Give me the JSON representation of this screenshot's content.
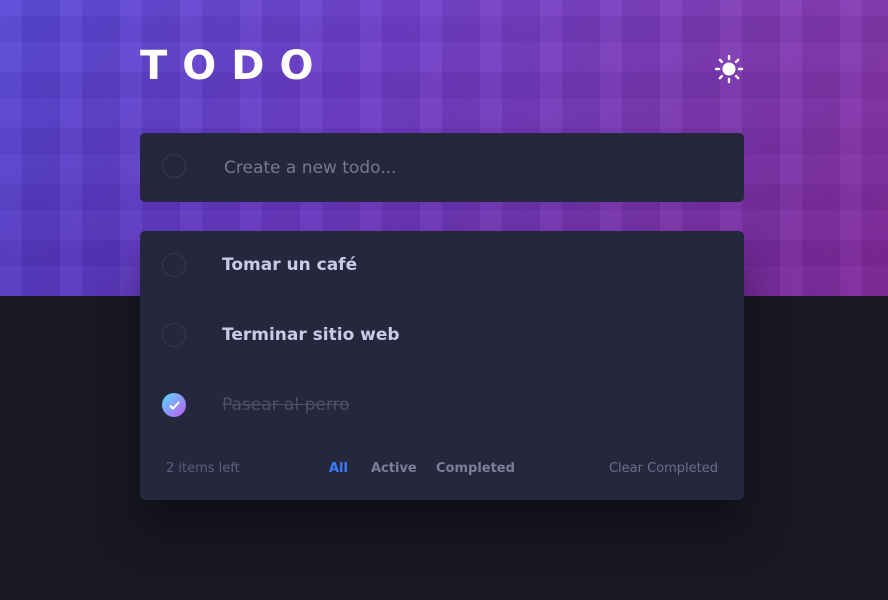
{
  "app": {
    "title": "TODO",
    "theme_icon": "sun-icon"
  },
  "new_todo": {
    "placeholder": "Create a new todo..."
  },
  "todos": [
    {
      "text": "Tomar un café",
      "completed": false
    },
    {
      "text": "Terminar sitio web",
      "completed": false
    },
    {
      "text": "Pasear al perro",
      "completed": true
    }
  ],
  "footer": {
    "items_left": "2 items left",
    "filters": [
      "All",
      "Active",
      "Completed"
    ],
    "active_filter": "All",
    "clear_label": "Clear Completed"
  },
  "colors": {
    "accent": "#3a7cfd",
    "card": "#25273d",
    "background": "#171823",
    "check_gradient_start": "#55ddff",
    "check_gradient_end": "#c058f3"
  }
}
